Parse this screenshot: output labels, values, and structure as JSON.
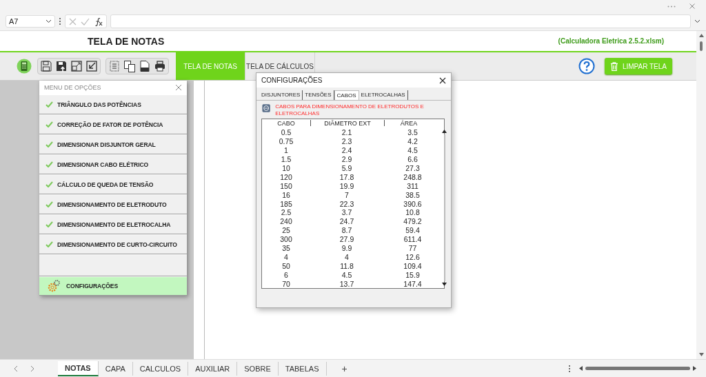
{
  "formula_bar": {
    "cell": "A7"
  },
  "header": {
    "title": "TELA DE NOTAS",
    "file": "(Calculadora Eletrica 2.5.2.xlsm)"
  },
  "nav_tabs": [
    {
      "label": "TELA DE NOTAS",
      "selected": true
    },
    {
      "label": "TELA DE CÁLCULOS",
      "selected": false
    }
  ],
  "clear_button": "LIMPAR TELA",
  "menu": {
    "title": "MENU DE OPÇÕES",
    "items": [
      {
        "label": "TRIÂNGULO DAS POTÊNCIAS"
      },
      {
        "label": "CORREÇÃO DE FATOR DE POTÊNCIA"
      },
      {
        "label": "DIMENSIONAR DISJUNTOR GERAL"
      },
      {
        "label": "DIMENSIONAR CABO ELÉTRICO"
      },
      {
        "label": "CÁLCULO DE QUEDA DE TENSÃO"
      },
      {
        "label": "DIMENSIONAMENTO DE ELETRODUTO"
      },
      {
        "label": "DIMENSIONAMENTO DE ELETROCALHA"
      },
      {
        "label": "DIMENSIONAMENTO DE CURTO-CIRCUITO"
      }
    ],
    "settings": {
      "label": "CONFIGURAÇÕES",
      "selected": true
    }
  },
  "dialog": {
    "title": "CONFIGURAÇÕES",
    "tabs": [
      {
        "label": "DISJUNTORES",
        "selected": false
      },
      {
        "label": "TENSÕES",
        "selected": false
      },
      {
        "label": "CABOS",
        "selected": true
      },
      {
        "label": "ELETROCALHAS",
        "selected": false
      }
    ],
    "caption": "CABOS PARA DIMENSIONAMENTO DE ELETRODUTOS E ELETROCALHAS",
    "columns": [
      "CABO",
      "DIÂMETRO EXT",
      "ÁREA"
    ],
    "rows": [
      [
        "0.5",
        "2.1",
        "3.5"
      ],
      [
        "0.75",
        "2.3",
        "4.2"
      ],
      [
        "1",
        "2.4",
        "4.5"
      ],
      [
        "1.5",
        "2.9",
        "6.6"
      ],
      [
        "10",
        "5.9",
        "27.3"
      ],
      [
        "120",
        "17.8",
        "248.8"
      ],
      [
        "150",
        "19.9",
        "311"
      ],
      [
        "16",
        "7",
        "38.5"
      ],
      [
        "185",
        "22.3",
        "390.6"
      ],
      [
        "2.5",
        "3.7",
        "10.8"
      ],
      [
        "240",
        "24.7",
        "479.2"
      ],
      [
        "25",
        "8.7",
        "59.4"
      ],
      [
        "300",
        "27.9",
        "611.4"
      ],
      [
        "35",
        "9.9",
        "77"
      ],
      [
        "4",
        "4",
        "12.6"
      ],
      [
        "50",
        "11.8",
        "109.4"
      ],
      [
        "6",
        "4.5",
        "15.9"
      ],
      [
        "70",
        "13.7",
        "147.4"
      ]
    ]
  },
  "sheet_tabs": [
    {
      "label": "NOTAS",
      "selected": true
    },
    {
      "label": "CAPA",
      "selected": false
    },
    {
      "label": "CALCULOS",
      "selected": false
    },
    {
      "label": "AUXILIAR",
      "selected": false
    },
    {
      "label": "SOBRE",
      "selected": false
    },
    {
      "label": "TABELAS",
      "selected": false
    }
  ],
  "add_sheet": "+"
}
